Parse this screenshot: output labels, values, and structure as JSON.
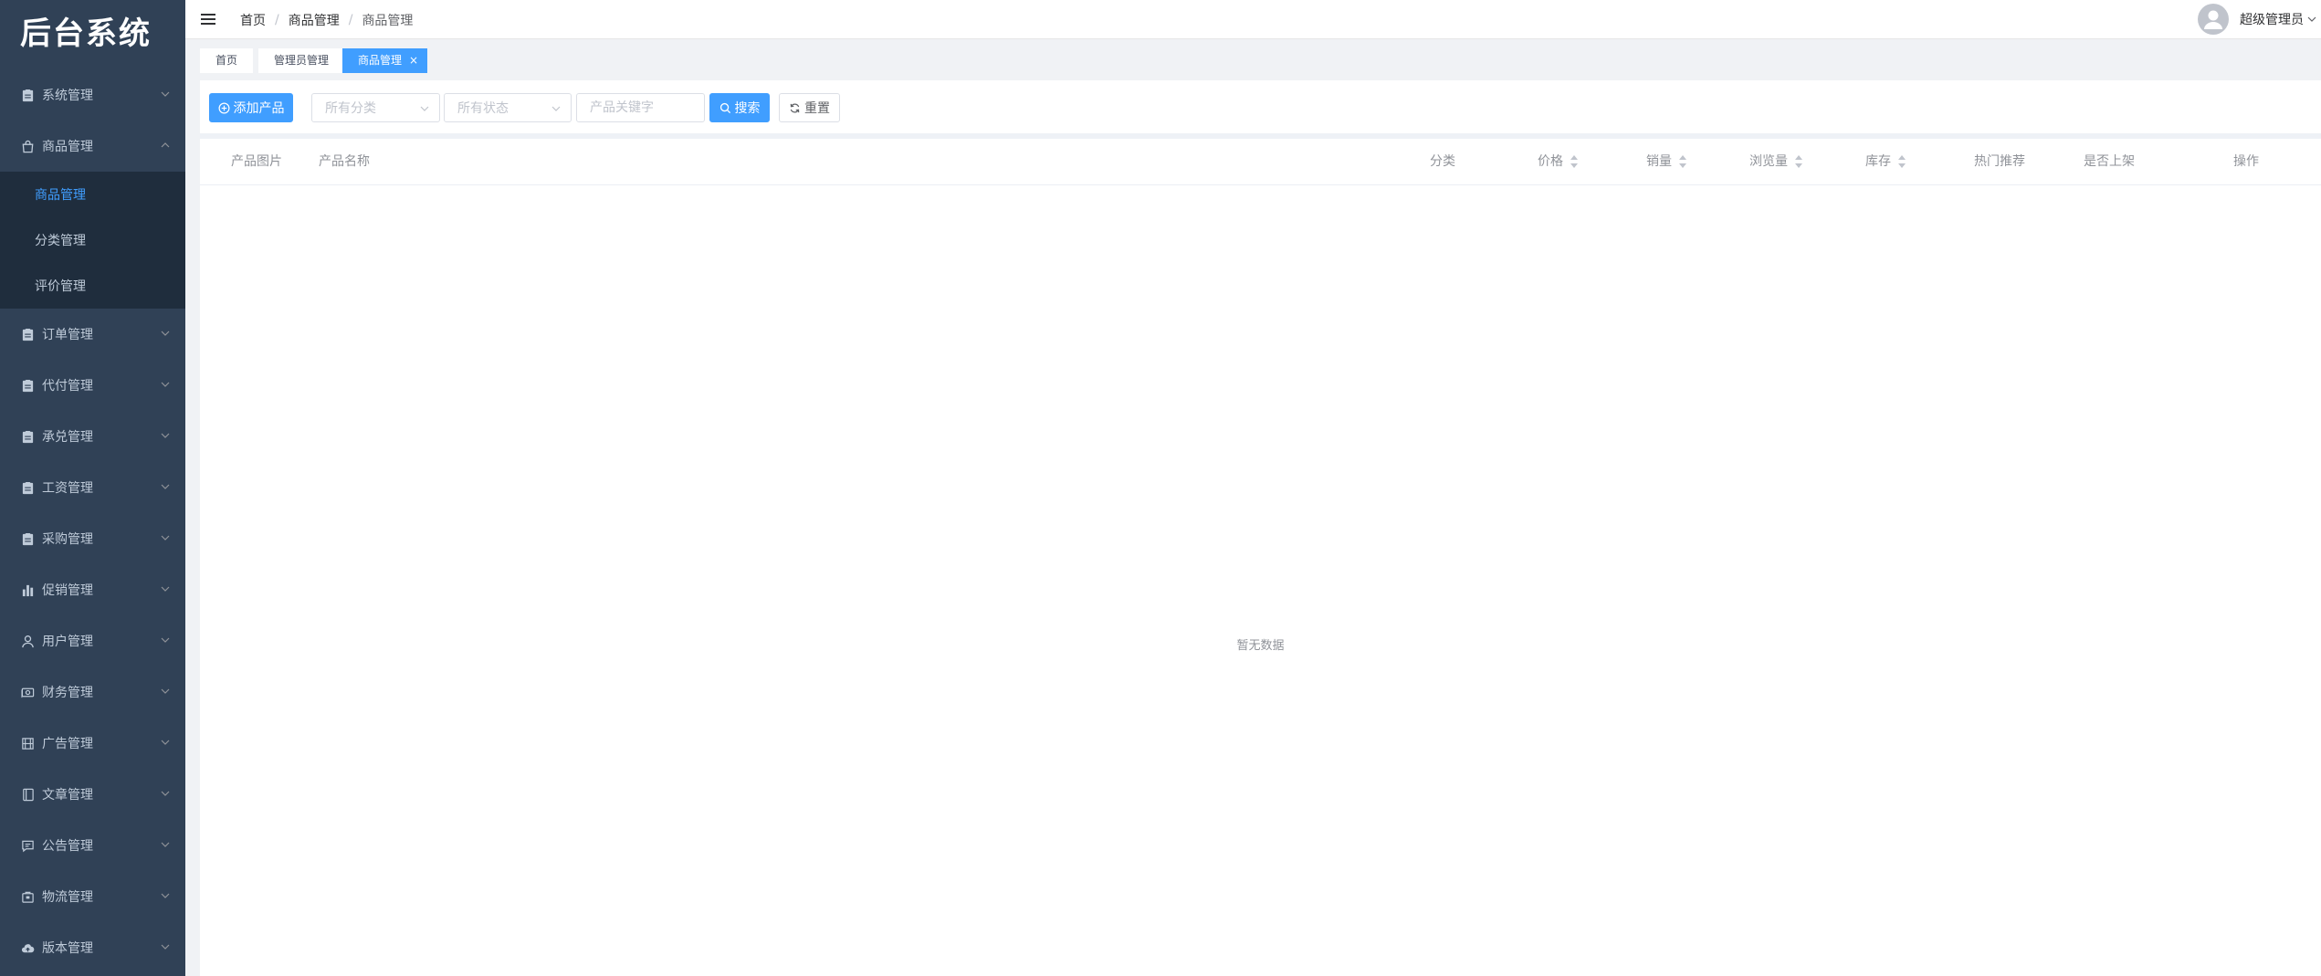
{
  "app": {
    "title": "后台系统"
  },
  "sidebar": {
    "items": [
      {
        "label": "系统管理",
        "icon": "clipboard-icon",
        "expanded": false
      },
      {
        "label": "商品管理",
        "icon": "shopping-bag-icon",
        "expanded": true,
        "children": [
          {
            "label": "商品管理",
            "active": true
          },
          {
            "label": "分类管理",
            "active": false
          },
          {
            "label": "评价管理",
            "active": false
          }
        ]
      },
      {
        "label": "订单管理",
        "icon": "clipboard-icon",
        "expanded": false
      },
      {
        "label": "代付管理",
        "icon": "clipboard-icon",
        "expanded": false
      },
      {
        "label": "承兑管理",
        "icon": "clipboard-icon",
        "expanded": false
      },
      {
        "label": "工资管理",
        "icon": "clipboard-icon",
        "expanded": false
      },
      {
        "label": "采购管理",
        "icon": "clipboard-icon",
        "expanded": false
      },
      {
        "label": "促销管理",
        "icon": "bar-chart-icon",
        "expanded": false
      },
      {
        "label": "用户管理",
        "icon": "user-icon",
        "expanded": false
      },
      {
        "label": "财务管理",
        "icon": "money-icon",
        "expanded": false
      },
      {
        "label": "广告管理",
        "icon": "film-icon",
        "expanded": false
      },
      {
        "label": "文章管理",
        "icon": "notebook-icon",
        "expanded": false
      },
      {
        "label": "公告管理",
        "icon": "message-icon",
        "expanded": false
      },
      {
        "label": "物流管理",
        "icon": "package-icon",
        "expanded": false
      },
      {
        "label": "版本管理",
        "icon": "cloud-upload-icon",
        "expanded": false
      }
    ]
  },
  "breadcrumb": [
    "首页",
    "商品管理",
    "商品管理"
  ],
  "user": {
    "name": "超级管理员"
  },
  "tags": [
    {
      "label": "首页",
      "active": false
    },
    {
      "label": "管理员管理",
      "active": false
    },
    {
      "label": "商品管理",
      "active": true,
      "close": "×"
    }
  ],
  "toolbar": {
    "add_label": "添加产品",
    "category_placeholder": "所有分类",
    "status_placeholder": "所有状态",
    "keyword_placeholder": "产品关键字",
    "search_label": "搜索",
    "reset_label": "重置"
  },
  "table": {
    "columns": [
      {
        "label": "产品图片",
        "sortable": false
      },
      {
        "label": "产品名称",
        "sortable": false
      },
      {
        "label": "分类",
        "sortable": false
      },
      {
        "label": "价格",
        "sortable": true
      },
      {
        "label": "销量",
        "sortable": true
      },
      {
        "label": "浏览量",
        "sortable": true
      },
      {
        "label": "库存",
        "sortable": true
      },
      {
        "label": "热门推荐",
        "sortable": false
      },
      {
        "label": "是否上架",
        "sortable": false
      },
      {
        "label": "操作",
        "sortable": false
      }
    ],
    "rows": [],
    "empty_text": "暂无数据"
  },
  "colors": {
    "sidebar_bg": "#304156",
    "submenu_bg": "#1f2d3d",
    "accent": "#409eff"
  }
}
